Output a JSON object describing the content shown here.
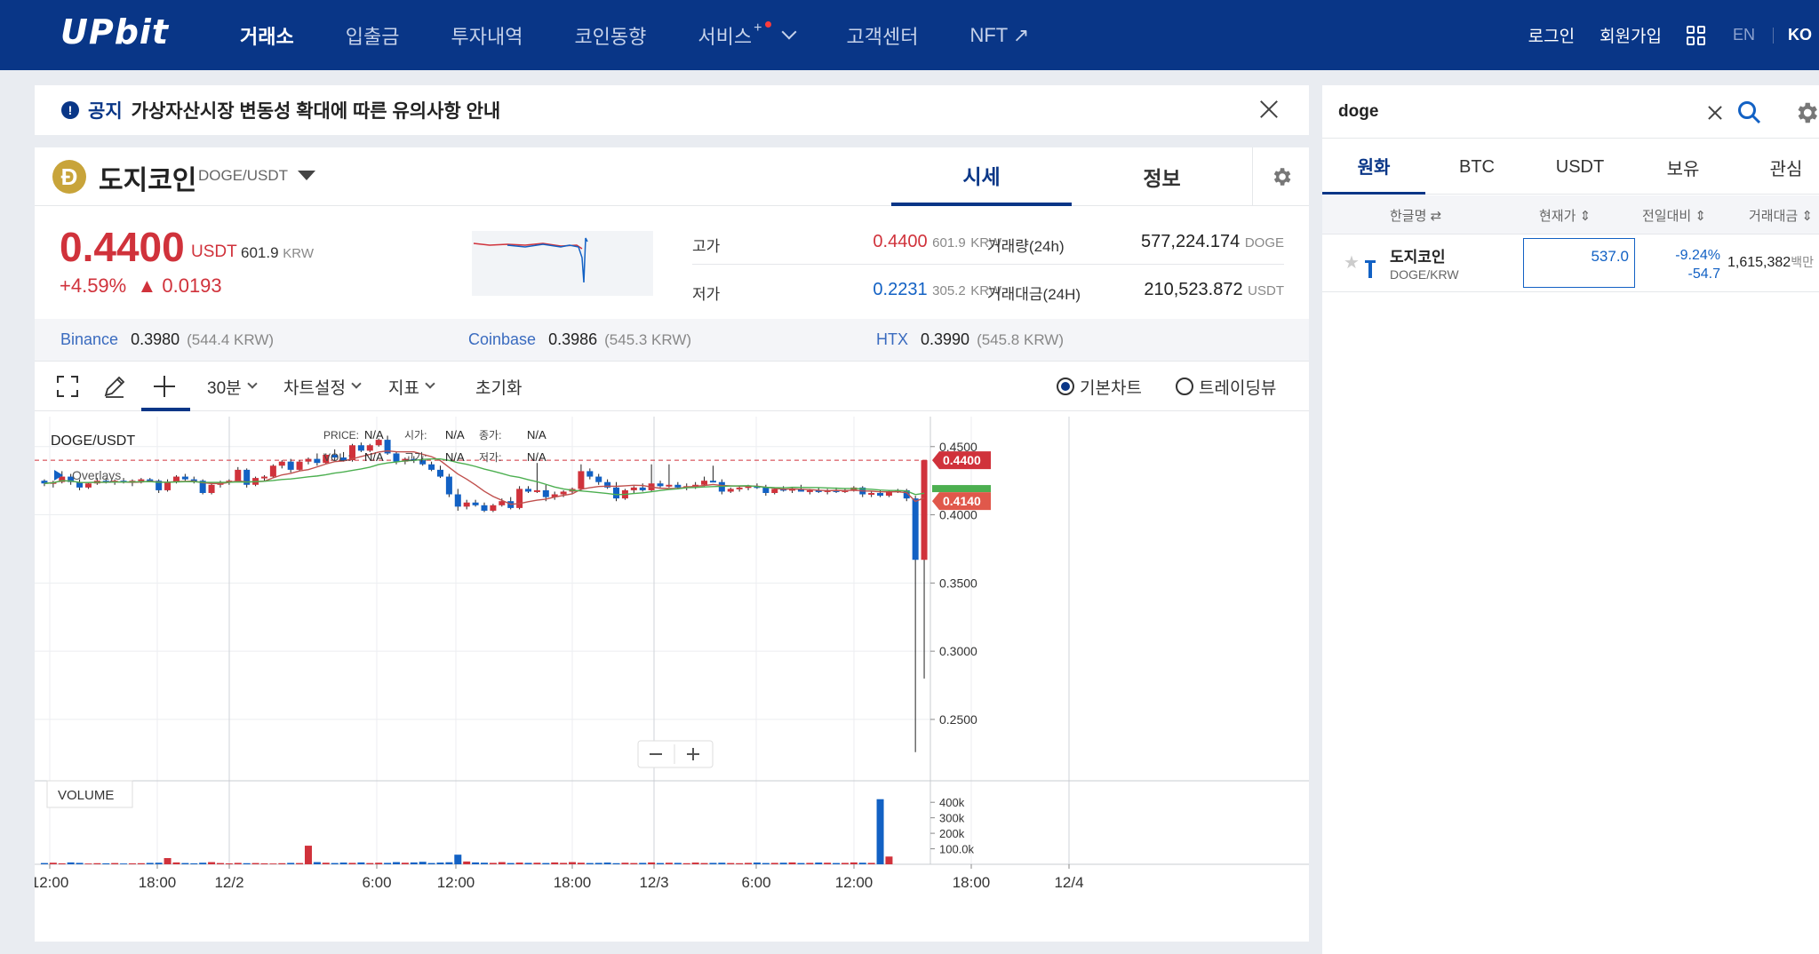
{
  "nav": {
    "logo": "UPbit",
    "items": [
      "거래소",
      "입출금",
      "투자내역",
      "코인동향",
      "서비스",
      "고객센터",
      "NFT ↗"
    ],
    "service_plus": "+",
    "login": "로그인",
    "signup": "회원가입",
    "lang_en": "EN",
    "lang_ko": "KO"
  },
  "notice": {
    "tag": "공지",
    "text": "가상자산시장 변동성 확대에 따른 유의사항 안내"
  },
  "coin": {
    "logo_letter": "Ð",
    "name": "도지코인",
    "pair": "DOGE/USDT",
    "tabs": [
      "시세",
      "정보"
    ],
    "price": "0.4400",
    "unit": "USDT",
    "krw_value": "601.9",
    "krw_label": "KRW",
    "change_pct": "+4.59%",
    "change_abs": "▲ 0.0193",
    "high_label": "고가",
    "high_value": "0.4400",
    "high_krw": "601.9",
    "low_label": "저가",
    "low_value": "0.2231",
    "low_krw": "305.2",
    "vol_label": "거래량(24h)",
    "vol_value": "577,224.174",
    "vol_unit": "DOGE",
    "amt_label": "거래대금(24H)",
    "amt_value": "210,523.872",
    "amt_unit": "USDT",
    "colors": {
      "up": "#d0323b",
      "down": "#1261c4",
      "brand": "#093687"
    }
  },
  "exchanges": [
    {
      "name": "Binance",
      "price": "0.3980",
      "krw": "(544.4 KRW)"
    },
    {
      "name": "Coinbase",
      "price": "0.3986",
      "krw": "(545.3 KRW)"
    },
    {
      "name": "HTX",
      "price": "0.3990",
      "krw": "(545.8 KRW)"
    }
  ],
  "toolbar": {
    "interval": "30분",
    "chart_settings": "차트설정",
    "indicator": "지표",
    "reset": "초기화",
    "basic_chart": "기본차트",
    "tradingview": "트레이딩뷰"
  },
  "chart_data": {
    "type": "candlestick",
    "symbol": "DOGE/USDT",
    "legend": {
      "price_label": "PRICE:",
      "price_value": "N/A",
      "open_label": "시가:",
      "open_value": "N/A",
      "close_label": "종가:",
      "close_value": "N/A",
      "vol_label": "VOL.:",
      "vol_value": "N/A",
      "high_label": "고가:",
      "high_value": "N/A",
      "low_label": "저가:",
      "low_value": "N/A"
    },
    "overlays_label": "Overlays",
    "volume_label": "VOLUME",
    "y_ticks": [
      "0.4500",
      "0.4000",
      "0.3500",
      "0.3000",
      "0.2500"
    ],
    "y_tick_values": [
      0.45,
      0.4,
      0.35,
      0.3,
      0.25
    ],
    "ylim": [
      0.205,
      0.472
    ],
    "current_price_tag": "0.4400",
    "current_price": 0.44,
    "ma_tag": "0.4140",
    "ma_value": 0.414,
    "vol_ticks": [
      "400k",
      "300k",
      "200k",
      "100.0k"
    ],
    "vol_tick_values": [
      400000,
      300000,
      200000,
      100000
    ],
    "vol_max": 470000,
    "x_ticks": [
      "12:00",
      "18:00",
      "12/2",
      "6:00",
      "12:00",
      "18:00",
      "12/3",
      "6:00",
      "12:00",
      "18:00",
      "12/4"
    ],
    "candles": [
      [
        0.425,
        0.426,
        0.421,
        0.423
      ],
      [
        0.423,
        0.425,
        0.42,
        0.424
      ],
      [
        0.424,
        0.432,
        0.423,
        0.428
      ],
      [
        0.428,
        0.43,
        0.422,
        0.424
      ],
      [
        0.424,
        0.426,
        0.418,
        0.42
      ],
      [
        0.42,
        0.424,
        0.419,
        0.423
      ],
      [
        0.423,
        0.427,
        0.422,
        0.425
      ],
      [
        0.425,
        0.427,
        0.423,
        0.424
      ],
      [
        0.424,
        0.426,
        0.422,
        0.425
      ],
      [
        0.425,
        0.427,
        0.423,
        0.424
      ],
      [
        0.424,
        0.426,
        0.421,
        0.425
      ],
      [
        0.425,
        0.427,
        0.423,
        0.426
      ],
      [
        0.426,
        0.427,
        0.424,
        0.425
      ],
      [
        0.425,
        0.426,
        0.416,
        0.418
      ],
      [
        0.418,
        0.426,
        0.417,
        0.424
      ],
      [
        0.424,
        0.429,
        0.423,
        0.428
      ],
      [
        0.428,
        0.43,
        0.425,
        0.426
      ],
      [
        0.426,
        0.428,
        0.423,
        0.425
      ],
      [
        0.425,
        0.426,
        0.415,
        0.416
      ],
      [
        0.416,
        0.424,
        0.415,
        0.422
      ],
      [
        0.422,
        0.425,
        0.42,
        0.424
      ],
      [
        0.424,
        0.426,
        0.422,
        0.425
      ],
      [
        0.425,
        0.435,
        0.424,
        0.433
      ],
      [
        0.433,
        0.434,
        0.42,
        0.422
      ],
      [
        0.422,
        0.428,
        0.421,
        0.427
      ],
      [
        0.427,
        0.429,
        0.425,
        0.428
      ],
      [
        0.428,
        0.437,
        0.427,
        0.436
      ],
      [
        0.436,
        0.44,
        0.434,
        0.439
      ],
      [
        0.439,
        0.441,
        0.431,
        0.433
      ],
      [
        0.433,
        0.44,
        0.432,
        0.439
      ],
      [
        0.439,
        0.442,
        0.437,
        0.441
      ],
      [
        0.441,
        0.445,
        0.436,
        0.438
      ],
      [
        0.438,
        0.445,
        0.437,
        0.444
      ],
      [
        0.444,
        0.448,
        0.44,
        0.442
      ],
      [
        0.442,
        0.446,
        0.439,
        0.44
      ],
      [
        0.44,
        0.452,
        0.439,
        0.451
      ],
      [
        0.451,
        0.453,
        0.446,
        0.447
      ],
      [
        0.447,
        0.452,
        0.446,
        0.451
      ],
      [
        0.451,
        0.456,
        0.45,
        0.455
      ],
      [
        0.455,
        0.458,
        0.444,
        0.445
      ],
      [
        0.445,
        0.446,
        0.437,
        0.439
      ],
      [
        0.439,
        0.442,
        0.437,
        0.441
      ],
      [
        0.441,
        0.443,
        0.438,
        0.44
      ],
      [
        0.44,
        0.442,
        0.436,
        0.437
      ],
      [
        0.437,
        0.439,
        0.432,
        0.433
      ],
      [
        0.433,
        0.436,
        0.427,
        0.428
      ],
      [
        0.428,
        0.43,
        0.413,
        0.415
      ],
      [
        0.415,
        0.419,
        0.403,
        0.406
      ],
      [
        0.406,
        0.411,
        0.404,
        0.409
      ],
      [
        0.409,
        0.411,
        0.406,
        0.407
      ],
      [
        0.407,
        0.409,
        0.402,
        0.403
      ],
      [
        0.403,
        0.408,
        0.402,
        0.407
      ],
      [
        0.407,
        0.412,
        0.406,
        0.41
      ],
      [
        0.41,
        0.413,
        0.404,
        0.405
      ],
      [
        0.405,
        0.421,
        0.404,
        0.419
      ],
      [
        0.419,
        0.421,
        0.416,
        0.417
      ],
      [
        0.417,
        0.438,
        0.416,
        0.418
      ],
      [
        0.418,
        0.422,
        0.41,
        0.413
      ],
      [
        0.413,
        0.417,
        0.411,
        0.415
      ],
      [
        0.415,
        0.418,
        0.413,
        0.417
      ],
      [
        0.417,
        0.42,
        0.415,
        0.419
      ],
      [
        0.419,
        0.437,
        0.418,
        0.432
      ],
      [
        0.432,
        0.434,
        0.426,
        0.428
      ],
      [
        0.428,
        0.43,
        0.422,
        0.424
      ],
      [
        0.424,
        0.426,
        0.419,
        0.42
      ],
      [
        0.42,
        0.424,
        0.41,
        0.412
      ],
      [
        0.412,
        0.419,
        0.411,
        0.418
      ],
      [
        0.418,
        0.421,
        0.416,
        0.42
      ],
      [
        0.42,
        0.423,
        0.417,
        0.418
      ],
      [
        0.418,
        0.437,
        0.417,
        0.423
      ],
      [
        0.423,
        0.425,
        0.42,
        0.421
      ],
      [
        0.421,
        0.437,
        0.42,
        0.422
      ],
      [
        0.422,
        0.424,
        0.419,
        0.42
      ],
      [
        0.42,
        0.423,
        0.418,
        0.421
      ],
      [
        0.421,
        0.424,
        0.419,
        0.422
      ],
      [
        0.422,
        0.428,
        0.421,
        0.425
      ],
      [
        0.425,
        0.436,
        0.424,
        0.424
      ],
      [
        0.424,
        0.426,
        0.415,
        0.417
      ],
      [
        0.417,
        0.42,
        0.416,
        0.419
      ],
      [
        0.419,
        0.421,
        0.417,
        0.42
      ],
      [
        0.42,
        0.422,
        0.418,
        0.421
      ],
      [
        0.421,
        0.423,
        0.419,
        0.42
      ],
      [
        0.42,
        0.422,
        0.414,
        0.416
      ],
      [
        0.416,
        0.42,
        0.415,
        0.419
      ],
      [
        0.419,
        0.421,
        0.417,
        0.418
      ],
      [
        0.418,
        0.42,
        0.416,
        0.419
      ],
      [
        0.419,
        0.422,
        0.418,
        0.417
      ],
      [
        0.417,
        0.419,
        0.415,
        0.418
      ],
      [
        0.418,
        0.42,
        0.416,
        0.417
      ],
      [
        0.417,
        0.419,
        0.415,
        0.418
      ],
      [
        0.418,
        0.42,
        0.416,
        0.417
      ],
      [
        0.417,
        0.419,
        0.416,
        0.418
      ],
      [
        0.418,
        0.421,
        0.417,
        0.42
      ],
      [
        0.42,
        0.421,
        0.413,
        0.415
      ],
      [
        0.415,
        0.417,
        0.413,
        0.416
      ],
      [
        0.416,
        0.418,
        0.413,
        0.414
      ],
      [
        0.414,
        0.418,
        0.413,
        0.417
      ],
      [
        0.417,
        0.419,
        0.416,
        0.418
      ],
      [
        0.418,
        0.419,
        0.41,
        0.412
      ],
      [
        0.412,
        0.414,
        0.226,
        0.367
      ],
      [
        0.367,
        0.44,
        0.28,
        0.44
      ]
    ],
    "volumes": [
      8,
      10,
      6,
      12,
      9,
      5,
      7,
      6,
      8,
      5,
      6,
      7,
      9,
      10,
      40,
      12,
      8,
      6,
      10,
      14,
      8,
      6,
      9,
      7,
      8,
      6,
      5,
      7,
      9,
      8,
      120,
      14,
      10,
      8,
      11,
      9,
      12,
      8,
      10,
      9,
      14,
      10,
      12,
      16,
      8,
      11,
      13,
      62,
      18,
      12,
      10,
      9,
      14,
      8,
      11,
      9,
      10,
      8,
      12,
      9,
      14,
      10,
      8,
      9,
      11,
      7,
      10,
      8,
      9,
      12,
      8,
      10,
      9,
      7,
      11,
      8,
      9,
      10,
      8,
      7,
      9,
      11,
      8,
      9,
      10,
      12,
      8,
      9,
      11,
      10,
      8,
      9,
      12,
      10,
      9,
      420,
      50
    ]
  },
  "side": {
    "search_value": "doge",
    "tabs": [
      "원화",
      "BTC",
      "USDT",
      "보유",
      "관심"
    ],
    "headers": [
      "한글명",
      "현재가",
      "전일대비",
      "거래대금"
    ],
    "rows": [
      {
        "name": "도지코인",
        "code": "DOGE/KRW",
        "price": "537.0",
        "chg_pct": "-9.24%",
        "chg_abs": "-54.7",
        "amount": "1,615,382",
        "amount_unit": "백만"
      }
    ]
  }
}
